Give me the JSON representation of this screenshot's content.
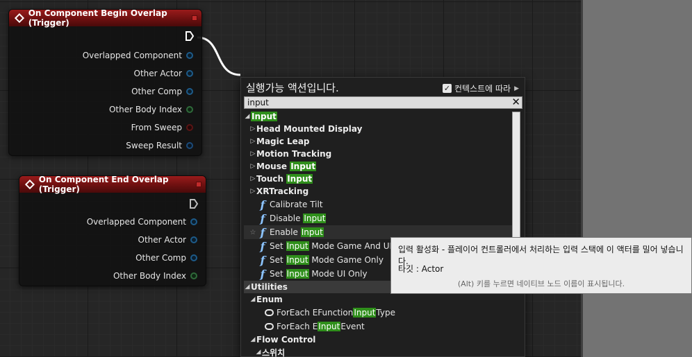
{
  "begin_overlap_node": {
    "title": "On Component Begin Overlap (Trigger)",
    "pins": [
      "Overlapped Component",
      "Other Actor",
      "Other Comp",
      "Other Body Index",
      "From Sweep",
      "Sweep Result"
    ]
  },
  "end_overlap_node": {
    "title": "On Component End Overlap (Trigger)",
    "pins": [
      "Overlapped Component",
      "Other Actor",
      "Other Comp",
      "Other Body Index"
    ]
  },
  "action_menu": {
    "title": "실행가능 액션입니다.",
    "context_label": "컨텍스트에 따라",
    "context_checked": true,
    "search_value": "input",
    "search_clear": "✕",
    "items": [
      {
        "type": "category",
        "expanded": true,
        "pre": "",
        "hl": "Input",
        "post": ""
      },
      {
        "type": "subcategory",
        "pre": "Head Mounted Display",
        "hl": "",
        "post": ""
      },
      {
        "type": "subcategory",
        "pre": "Magic Leap",
        "hl": "",
        "post": ""
      },
      {
        "type": "subcategory",
        "pre": "Motion Tracking",
        "hl": "",
        "post": ""
      },
      {
        "type": "subcategory",
        "pre": "Mouse ",
        "hl": "Input",
        "post": ""
      },
      {
        "type": "subcategory",
        "pre": "Touch ",
        "hl": "Input",
        "post": ""
      },
      {
        "type": "subcategory",
        "pre": "XRTracking",
        "hl": "",
        "post": ""
      },
      {
        "type": "function",
        "pre": "Calibrate Tilt",
        "hl": "",
        "post": ""
      },
      {
        "type": "function",
        "pre": "Disable ",
        "hl": "Input",
        "post": ""
      },
      {
        "type": "function",
        "pre": "Enable ",
        "hl": "Input",
        "post": "",
        "hovered": true
      },
      {
        "type": "function",
        "pre": "Set ",
        "hl": "Input",
        "post": " Mode Game And UI"
      },
      {
        "type": "function",
        "pre": "Set ",
        "hl": "Input",
        "post": " Mode Game Only"
      },
      {
        "type": "function",
        "pre": "Set ",
        "hl": "Input",
        "post": " Mode UI Only"
      },
      {
        "type": "category",
        "expanded": true,
        "pre": "Utilities",
        "hl": "",
        "post": "",
        "bar": true
      },
      {
        "type": "subcategory-open",
        "pre": "Enum",
        "hl": "",
        "post": ""
      },
      {
        "type": "loop",
        "pre": "ForEach EFunction",
        "hl": "Input",
        "post": "Type"
      },
      {
        "type": "loop",
        "pre": "ForEach E",
        "hl": "Input",
        "post": "Event"
      },
      {
        "type": "subcategory-open",
        "pre": "Flow Control",
        "hl": "",
        "post": ""
      },
      {
        "type": "subcategory-open2",
        "pre": "스위치",
        "hl": "",
        "post": ""
      }
    ]
  },
  "tooltip": {
    "description": "입력 활성화 - 플레이어 컨트롤러에서 처리하는 입력 스택에 이 액터를 밀어 넣습니다.",
    "target": "타깃 : Actor",
    "hint": "(Alt) 키를 누르면 네이티브 노드 이름이 표시됩니다."
  },
  "colors": {
    "highlight": "#2f8f1b",
    "event_header": "#8b1414",
    "function_icon": "#8cc4ff"
  }
}
